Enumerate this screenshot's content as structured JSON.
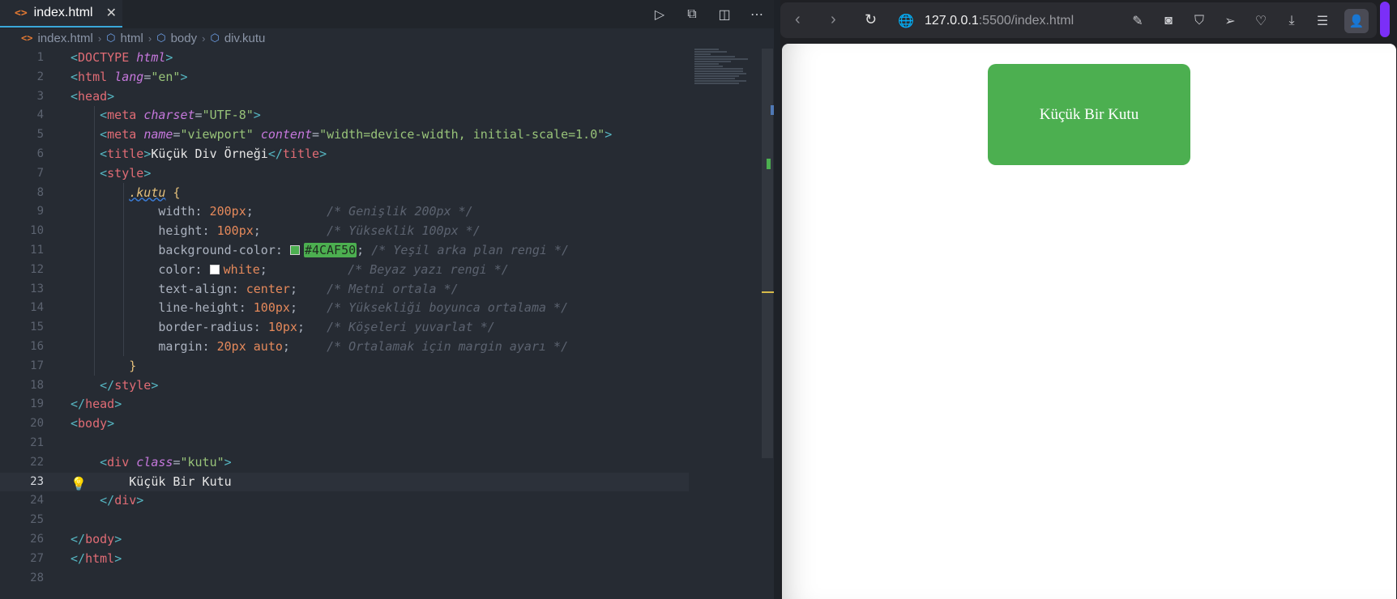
{
  "editor": {
    "tab": {
      "label": "index.html",
      "icon": "html-file-icon",
      "close": "✕"
    },
    "actions": [
      "run-icon",
      "split-preview-icon",
      "split-editor-icon",
      "more-icon"
    ],
    "breadcrumb": [
      "index.html",
      "html",
      "body",
      "div.kutu"
    ],
    "active_line": 23,
    "lines": [
      "1",
      "2",
      "3",
      "4",
      "5",
      "6",
      "7",
      "8",
      "9",
      "10",
      "11",
      "12",
      "13",
      "14",
      "15",
      "16",
      "17",
      "18",
      "19",
      "20",
      "21",
      "22",
      "23",
      "24",
      "25",
      "26",
      "27",
      "28"
    ],
    "code": {
      "doctype_bang": "<!",
      "doctype": "DOCTYPE",
      "doctype_html": "html",
      "html_open": "html",
      "lang_attr": "lang",
      "lang_val": "\"en\"",
      "head": "head",
      "meta": "meta",
      "charset_attr": "charset",
      "charset_val": "\"UTF-8\"",
      "name_attr": "name",
      "name_val": "\"viewport\"",
      "content_attr": "content",
      "content_val": "\"width=device-width, initial-scale=1.0\"",
      "title": "title",
      "title_text": "Küçük Div Örneği",
      "style": "style",
      "selector": ".kutu",
      "brace_open": "{",
      "brace_close": "}",
      "props": [
        {
          "name": "width",
          "value": "200px",
          "comment": "/* Genişlik 200px */"
        },
        {
          "name": "height",
          "value": "100px",
          "comment": "/* Yükseklik 100px */"
        },
        {
          "name": "background-color",
          "value": "#4CAF50",
          "comment": "/* Yeşil arka plan rengi */"
        },
        {
          "name": "color",
          "value": "white",
          "comment": "/* Beyaz yazı rengi */"
        },
        {
          "name": "text-align",
          "value": "center",
          "comment": "/* Metni ortala */"
        },
        {
          "name": "line-height",
          "value": "100px",
          "comment": "/* Yüksekliği boyunca ortalama */"
        },
        {
          "name": "border-radius",
          "value": "10px",
          "comment": "/* Köşeleri yuvarlat */"
        },
        {
          "name": "margin",
          "value": "20px auto",
          "comment": "/* Ortalamak için margin ayarı */"
        }
      ],
      "body": "body",
      "div": "div",
      "class_attr": "class",
      "class_val": "\"kutu\"",
      "div_text": "Küçük Bir Kutu"
    },
    "colors": {
      "swatch_green": "#4CAF50",
      "swatch_white": "#ffffff"
    }
  },
  "browser": {
    "url_host": "127.0.0.1",
    "url_rest": ":5500/index.html",
    "nav": [
      "back-icon",
      "forward-icon",
      "reload-icon"
    ],
    "actions": [
      "edit-icon",
      "screenshot-icon",
      "shield-icon",
      "send-icon",
      "heart-icon",
      "download-icon",
      "menu-icon",
      "profile-icon"
    ],
    "page": {
      "box_text": "Küçük Bir Kutu",
      "box_color": "#4CAF50"
    }
  }
}
